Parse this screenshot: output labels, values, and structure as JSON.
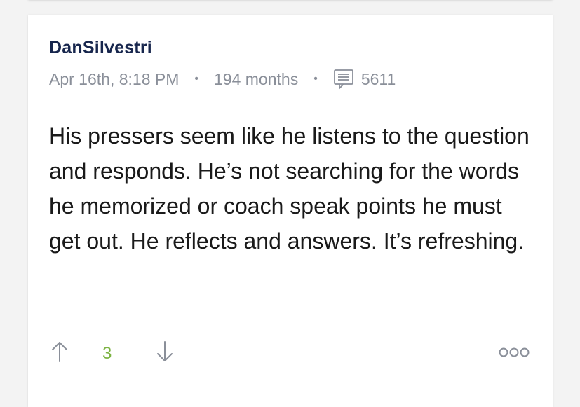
{
  "comment": {
    "author": "DanSilvestri",
    "timestamp": "Apr 16th, 8:18 PM",
    "member_age": "194 months",
    "comment_count": "5611",
    "text": "His pressers seem like he listens to the question and responds. He’s not searching for the words he memorized or coach speak points he must get out. He reflects and answers. It’s refreshing.",
    "votes": "3",
    "icons": {
      "comments": "comment-icon",
      "upvote": "arrow-up-icon",
      "downvote": "arrow-down-icon",
      "more": "more-options-icon"
    }
  },
  "colors": {
    "author": "#17264d",
    "meta": "#8a8f99",
    "votes": "#7cb342",
    "background": "#f3f3f3"
  }
}
